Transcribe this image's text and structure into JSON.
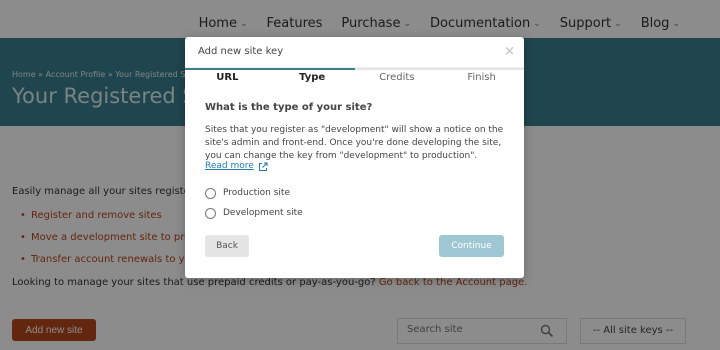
{
  "nav": {
    "items": [
      {
        "label": "Home",
        "dropdown": true
      },
      {
        "label": "Features",
        "dropdown": false
      },
      {
        "label": "Purchase",
        "dropdown": true
      },
      {
        "label": "Documentation",
        "dropdown": true
      },
      {
        "label": "Support",
        "dropdown": true
      },
      {
        "label": "Blog",
        "dropdown": true
      }
    ]
  },
  "banner": {
    "breadcrumb": "Home » Account Profile » Your Registered S",
    "title": "Your Registered Si"
  },
  "content": {
    "intro": "Easily manage all your sites register",
    "features": [
      "Register and remove sites",
      "Move a development site to proc",
      "Transfer account renewals to you"
    ],
    "prepaid_text": "Looking to manage your sites that use prepaid credits or pay-as-you-go?",
    "prepaid_link": "Go back to the Account page."
  },
  "toolbar": {
    "add_label": "Add new site",
    "search_placeholder": "Search site",
    "select_value": "-- All site keys --"
  },
  "modal": {
    "title": "Add new site key",
    "close_symbol": "×",
    "steps": [
      {
        "label": "URL",
        "bold": true,
        "done": true
      },
      {
        "label": "Type",
        "bold": true,
        "done": true
      },
      {
        "label": "Credits",
        "bold": false,
        "done": false
      },
      {
        "label": "Finish",
        "bold": false,
        "done": false
      }
    ],
    "question": "What is the type of your site?",
    "description": "Sites that you register as \"development\" will show a notice on the site's admin and front-end. Once you're done developing the site, you can change the key from \"development\" to production\".",
    "read_more": "Read more",
    "options": [
      "Production site",
      "Development site"
    ],
    "back_label": "Back",
    "continue_label": "Continue"
  },
  "colors": {
    "accent": "#3a7f8f",
    "brand": "#b5451b",
    "link": "#1f7bb5",
    "continue_disabled": "#9ec7d3"
  }
}
